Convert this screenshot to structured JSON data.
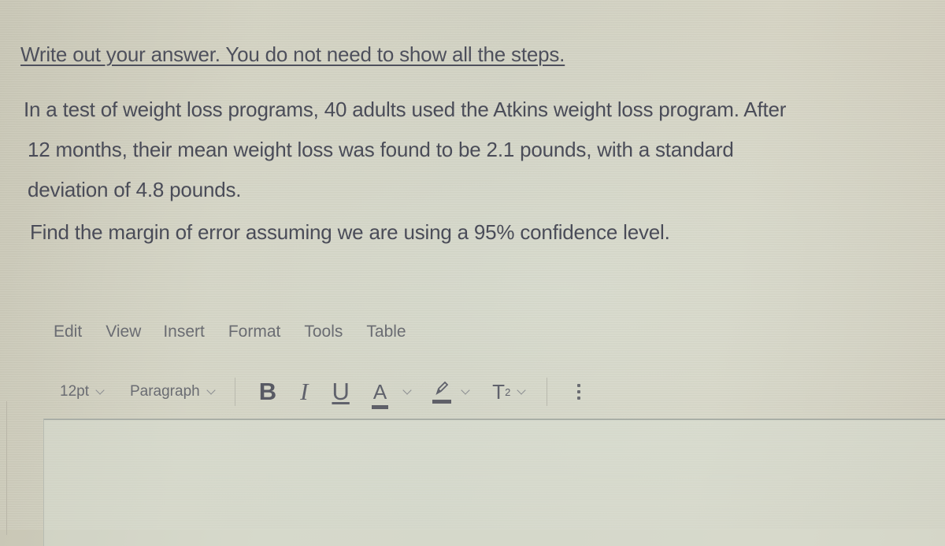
{
  "instruction": "Write out your answer. You do not need to show all the steps.",
  "question": {
    "lines": [
      "In a test of weight loss programs, 40 adults used the Atkins weight loss program. After",
      "12 months, their mean weight loss was found to be 2.1 pounds, with a standard",
      "deviation of 4.8 pounds."
    ],
    "prompt": "Find the margin of error assuming we are using a 95% confidence level."
  },
  "editor": {
    "menu": [
      "Edit",
      "View",
      "Insert",
      "Format",
      "Tools",
      "Table"
    ],
    "toolbar": {
      "font_size": "12pt",
      "block_format": "Paragraph",
      "bold": "B",
      "italic": "I",
      "underline": "U",
      "text_color": "A",
      "superscript_base": "T",
      "superscript_exp": "2"
    },
    "content": ""
  }
}
